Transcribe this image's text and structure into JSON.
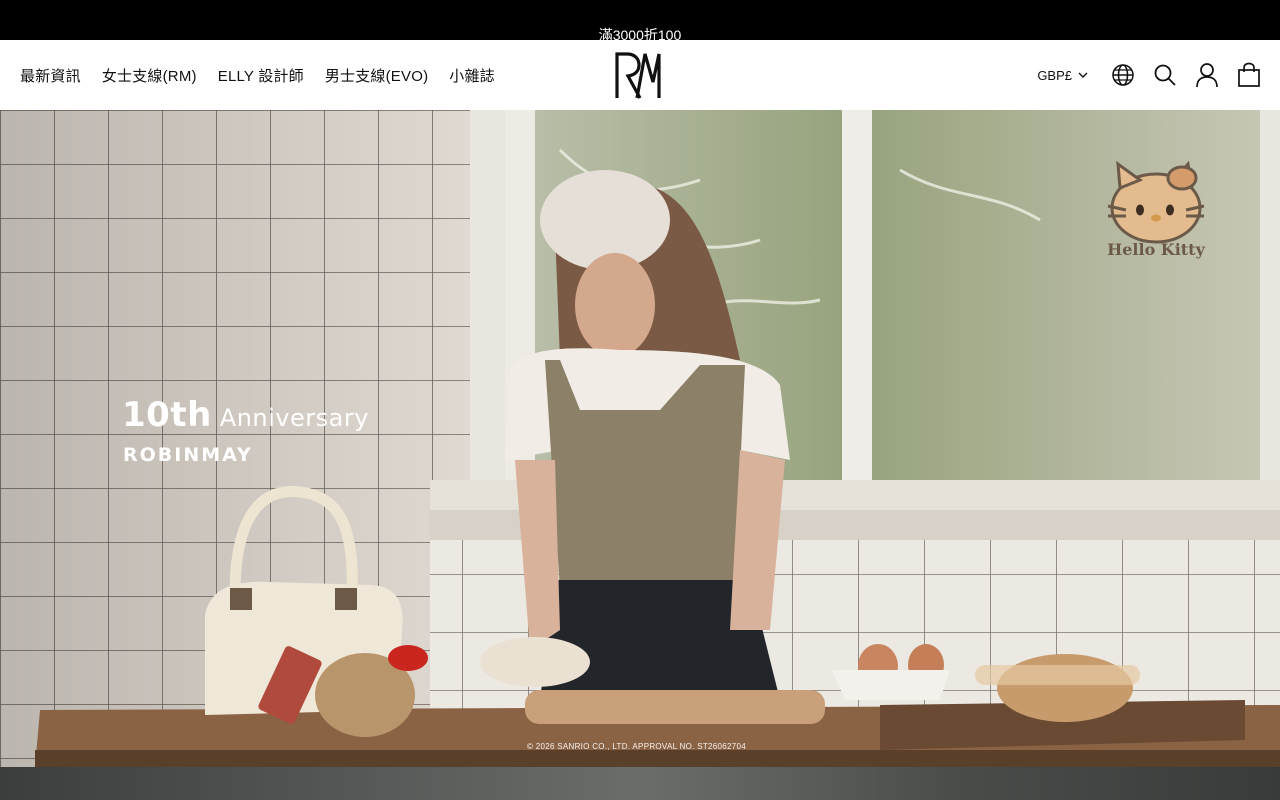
{
  "announcement": {
    "message": "滿3000折100"
  },
  "header": {
    "nav": [
      {
        "label": "最新資訊"
      },
      {
        "label": "女士支線(RM)"
      },
      {
        "label": "ELLY 設計師"
      },
      {
        "label": "男士支線(EVO)"
      },
      {
        "label": "小雜誌"
      }
    ],
    "logo_text": "RM",
    "currency": "GBP£",
    "icons": [
      "globe-icon",
      "search-icon",
      "account-icon",
      "cart-icon"
    ]
  },
  "hero": {
    "title_number": "10th",
    "title_word": "Anniversary",
    "subtitle": "ROBINMAY",
    "badge_text": "Hello Kitty",
    "copyright": "© 2026 SANRIO CO., LTD. APPROVAL NO. ST26062704"
  },
  "colors": {
    "announcement_bg": "#000000",
    "header_bg": "#ffffff",
    "text": "#111111"
  }
}
